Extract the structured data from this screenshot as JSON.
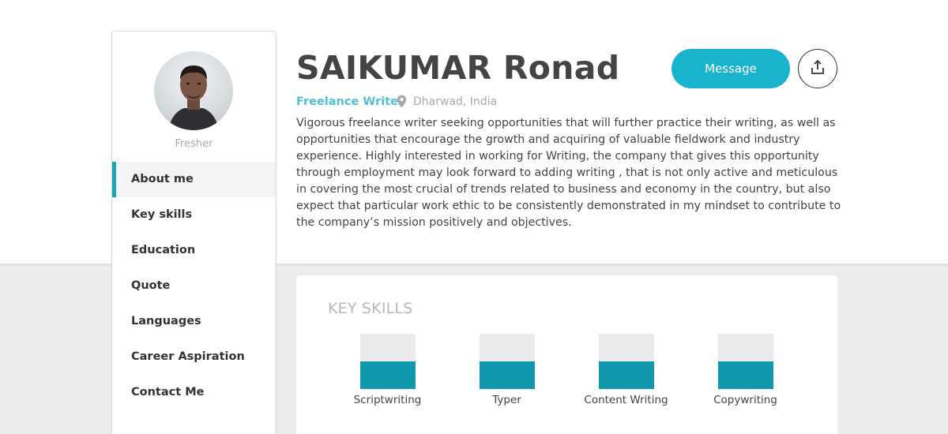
{
  "profile": {
    "name": "SAIKUMAR Ronad",
    "role": "Freelance Writer",
    "location": "Dharwad, India",
    "status": "Fresher",
    "bio": "Vigorous freelance writer seeking opportunities that will further practice their writing, as well as opportunities that encourage the growth and acquiring of valuable fieldwork and industry experience. Highly interested in working for Writing, the company that gives this opportunity through employment may look forward to adding writing , that is not only active and meticulous in covering the most crucial of trends related to business and economy in the country, but also expect that particular work ethic to be consistently demonstrated in my mindset to contribute to the company’s mission positively and objectives."
  },
  "actions": {
    "message_label": "Message",
    "share_icon": "share-icon"
  },
  "sidebar": {
    "items": [
      {
        "label": "About me",
        "active": true
      },
      {
        "label": "Key skills",
        "active": false
      },
      {
        "label": "Education",
        "active": false
      },
      {
        "label": "Quote",
        "active": false
      },
      {
        "label": "Languages",
        "active": false
      },
      {
        "label": "Career Aspiration",
        "active": false
      },
      {
        "label": "Contact Me",
        "active": false
      }
    ]
  },
  "key_skills": {
    "title": "KEY SKILLS",
    "skills": [
      {
        "name": "Scriptwriting",
        "level": 0.5
      },
      {
        "name": "Typer",
        "level": 0.5
      },
      {
        "name": "Content Writing",
        "level": 0.5
      },
      {
        "name": "Copywriting",
        "level": 0.5
      }
    ]
  },
  "colors": {
    "accent": "#1ab3ce",
    "skill_fill": "#1198ad",
    "role_text": "#4fc1d2"
  }
}
